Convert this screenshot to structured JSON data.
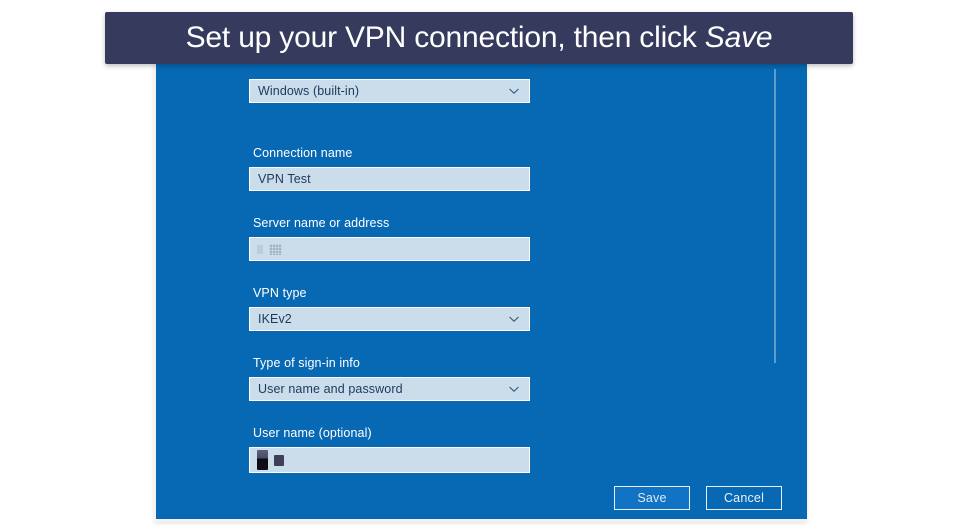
{
  "callout": {
    "text_before": "Set up your VPN connection, then click ",
    "emphasis": "Save",
    "background": "#363B5E",
    "text_color": "#FFFFFF"
  },
  "panel": {
    "background": "#0769B4",
    "field_background": "#CBDDEA",
    "field_text_color": "#1B3A5E",
    "label_color": "#FFFFFF"
  },
  "form": {
    "fields": [
      {
        "id": "vpn-provider",
        "label": "",
        "value": "Windows (built-in)",
        "type": "select",
        "icon": "chevron-down-icon",
        "redacted": false
      },
      {
        "id": "connection-name",
        "label": "Connection name",
        "value": "VPN Test",
        "type": "text",
        "redacted": false
      },
      {
        "id": "server-name",
        "label": "Server name or address",
        "value": "",
        "type": "text",
        "redacted": true
      },
      {
        "id": "vpn-type",
        "label": "VPN type",
        "value": "IKEv2",
        "type": "select",
        "icon": "chevron-down-icon",
        "redacted": false
      },
      {
        "id": "sign-in-type",
        "label": "Type of sign-in info",
        "value": "User name and password",
        "type": "select",
        "icon": "chevron-down-icon",
        "redacted": false
      },
      {
        "id": "user-name",
        "label": "User name (optional)",
        "value": "",
        "type": "text",
        "redacted": true
      }
    ]
  },
  "buttons": {
    "save_label": "Save",
    "cancel_label": "Cancel",
    "save_background": "#1173C4"
  },
  "scrollbar": {
    "color": "#5B9CCA"
  }
}
